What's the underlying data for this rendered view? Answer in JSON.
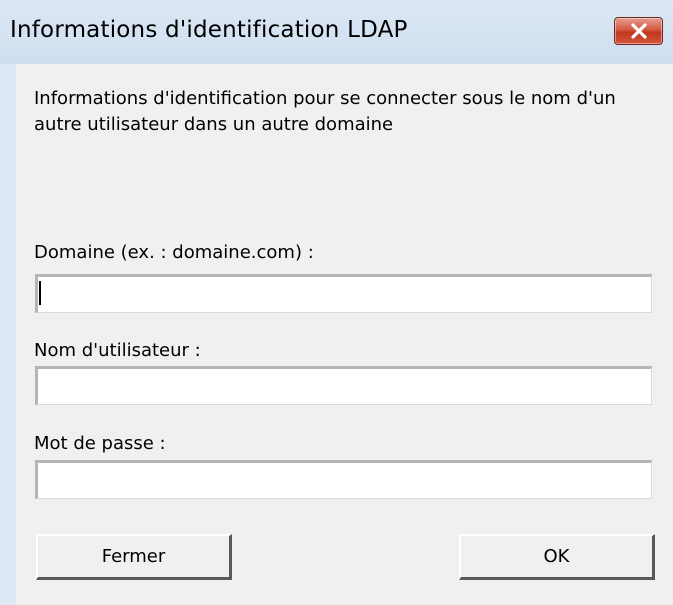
{
  "window": {
    "title": "Informations d'identification LDAP",
    "close_icon": "close-icon"
  },
  "dialog": {
    "description": "Informations d'identification pour se connecter sous le nom d'un autre utilisateur dans un autre domaine",
    "domain_label": "Domaine (ex. : domaine.com) :",
    "domain_value": "",
    "username_label": "Nom d'utilisateur :",
    "username_value": "",
    "password_label": "Mot de passe :",
    "password_value": ""
  },
  "buttons": {
    "close_label": "Fermer",
    "ok_label": "OK"
  },
  "colors": {
    "title_bar": "#dbe7f4",
    "client_background": "#f0f0f0",
    "close_button": "#c2361d"
  }
}
